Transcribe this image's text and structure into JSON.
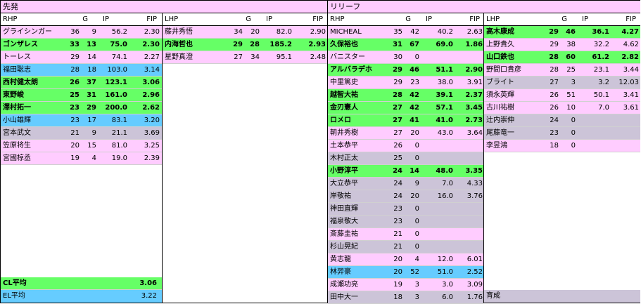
{
  "sections": {
    "starters": "先発",
    "relief": "リリーフ"
  },
  "headers": {
    "rhp": {
      "name": "RHP",
      "g": "G",
      "ip": "IP",
      "fip": "FIP"
    },
    "lhp": {
      "name": "LHP",
      "g": "G",
      "ip": "IP",
      "fip": "FIP"
    }
  },
  "starter_rhp": [
    {
      "name": "グライシンガー",
      "g": "36",
      "gs": "9",
      "ip": "56.2",
      "fip": "2.30",
      "bg": "pink",
      "bold": false
    },
    {
      "name": "ゴンザレス",
      "g": "33",
      "gs": "13",
      "ip": "75.0",
      "fip": "2.30",
      "bg": "green",
      "bold": true
    },
    {
      "name": "トーレス",
      "g": "29",
      "gs": "14",
      "ip": "74.1",
      "fip": "2.27",
      "bg": "pink",
      "bold": false
    },
    {
      "name": "福田聡志",
      "g": "28",
      "gs": "18",
      "ip": "103.0",
      "fip": "3.14",
      "bg": "blue",
      "bold": false
    },
    {
      "name": "西村健太朗",
      "g": "26",
      "gs": "37",
      "ip": "123.1",
      "fip": "3.06",
      "bg": "green",
      "bold": true
    },
    {
      "name": "東野峻",
      "g": "25",
      "gs": "31",
      "ip": "161.0",
      "fip": "2.96",
      "bg": "green",
      "bold": true
    },
    {
      "name": "澤村拓一",
      "g": "23",
      "gs": "29",
      "ip": "200.0",
      "fip": "2.62",
      "bg": "green",
      "bold": true
    },
    {
      "name": "小山雄輝",
      "g": "23",
      "gs": "17",
      "ip": "83.1",
      "fip": "3.20",
      "bg": "blue",
      "bold": false
    },
    {
      "name": "宮本武文",
      "g": "21",
      "gs": "9",
      "ip": "21.1",
      "fip": "3.69",
      "bg": "gray",
      "bold": false
    },
    {
      "name": "笠原将生",
      "g": "20",
      "gs": "15",
      "ip": "81.0",
      "fip": "3.25",
      "bg": "pink",
      "bold": false
    },
    {
      "name": "宮國椋丞",
      "g": "19",
      "gs": "4",
      "ip": "19.0",
      "fip": "2.39",
      "bg": "pink",
      "bold": false
    }
  ],
  "starter_lhp": [
    {
      "name": "藤井秀悟",
      "g": "34",
      "gs": "20",
      "ip": "82.0",
      "fip": "2.90",
      "bg": "pink",
      "bold": false
    },
    {
      "name": "内海哲也",
      "g": "29",
      "gs": "28",
      "ip": "185.2",
      "fip": "2.93",
      "bg": "green",
      "bold": true
    },
    {
      "name": "星野真澄",
      "g": "27",
      "gs": "34",
      "ip": "95.1",
      "fip": "2.48",
      "bg": "pink",
      "bold": false
    }
  ],
  "averages": [
    {
      "label": "CL平均",
      "fip": "3.06",
      "bg": "green",
      "bold": true
    },
    {
      "label": "EL平均",
      "fip": "3.22",
      "bg": "blue",
      "bold": false
    }
  ],
  "relief_rhp": [
    {
      "name": "MICHEAL",
      "g": "35",
      "gs": "42",
      "ip": "40.2",
      "fip": "2.63",
      "bg": "pink",
      "bold": false
    },
    {
      "name": "久保裕也",
      "g": "31",
      "gs": "67",
      "ip": "69.0",
      "fip": "1.86",
      "bg": "green",
      "bold": true
    },
    {
      "name": "バニスター",
      "g": "30",
      "gs": "0",
      "ip": "",
      "fip": "",
      "bg": "pink",
      "bold": false
    },
    {
      "name": "アルバラデホ",
      "g": "29",
      "gs": "46",
      "ip": "51.1",
      "fip": "2.90",
      "bg": "green",
      "bold": true
    },
    {
      "name": "中里篤史",
      "g": "29",
      "gs": "23",
      "ip": "38.0",
      "fip": "3.91",
      "bg": "pink",
      "bold": false
    },
    {
      "name": "越智大祐",
      "g": "28",
      "gs": "42",
      "ip": "39.1",
      "fip": "2.37",
      "bg": "green",
      "bold": true
    },
    {
      "name": "金刃憲人",
      "g": "27",
      "gs": "42",
      "ip": "57.1",
      "fip": "3.45",
      "bg": "green",
      "bold": true
    },
    {
      "name": "ロメロ",
      "g": "27",
      "gs": "41",
      "ip": "41.0",
      "fip": "2.73",
      "bg": "green",
      "bold": true
    },
    {
      "name": "朝井秀樹",
      "g": "27",
      "gs": "20",
      "ip": "43.0",
      "fip": "3.64",
      "bg": "pink",
      "bold": false
    },
    {
      "name": "土本恭平",
      "g": "26",
      "gs": "0",
      "ip": "",
      "fip": "",
      "bg": "pink",
      "bold": false
    },
    {
      "name": "木村正太",
      "g": "25",
      "gs": "0",
      "ip": "",
      "fip": "",
      "bg": "gray",
      "bold": false
    },
    {
      "name": "小野淳平",
      "g": "24",
      "gs": "14",
      "ip": "48.0",
      "fip": "3.35",
      "bg": "green",
      "bold": true
    },
    {
      "name": "大立恭平",
      "g": "24",
      "gs": "9",
      "ip": "7.0",
      "fip": "4.33",
      "bg": "gray",
      "bold": false
    },
    {
      "name": "岸敬祐",
      "g": "24",
      "gs": "20",
      "ip": "16.0",
      "fip": "3.76",
      "bg": "gray",
      "bold": false
    },
    {
      "name": "神田直輝",
      "g": "23",
      "gs": "0",
      "ip": "",
      "fip": "",
      "bg": "gray",
      "bold": false
    },
    {
      "name": "福泉敬大",
      "g": "23",
      "gs": "0",
      "ip": "",
      "fip": "",
      "bg": "gray",
      "bold": false
    },
    {
      "name": "斎藤圭祐",
      "g": "21",
      "gs": "0",
      "ip": "",
      "fip": "",
      "bg": "pink",
      "bold": false
    },
    {
      "name": "杉山晃紀",
      "g": "21",
      "gs": "0",
      "ip": "",
      "fip": "",
      "bg": "gray",
      "bold": false
    },
    {
      "name": "黄志龍",
      "g": "20",
      "gs": "4",
      "ip": "12.0",
      "fip": "6.01",
      "bg": "pink",
      "bold": false
    },
    {
      "name": "林羿豪",
      "g": "20",
      "gs": "52",
      "ip": "51.0",
      "fip": "2.52",
      "bg": "blue",
      "bold": false
    },
    {
      "name": "成瀬功亮",
      "g": "19",
      "gs": "3",
      "ip": "3.0",
      "fip": "3.09",
      "bg": "pink",
      "bold": false
    },
    {
      "name": "田中大一",
      "g": "18",
      "gs": "3",
      "ip": "6.0",
      "fip": "1.76",
      "bg": "gray",
      "bold": false
    }
  ],
  "relief_lhp": [
    {
      "name": "高木康成",
      "g": "29",
      "gs": "46",
      "ip": "36.1",
      "fip": "4.27",
      "bg": "green",
      "bold": true
    },
    {
      "name": "上野貴久",
      "g": "29",
      "gs": "38",
      "ip": "32.2",
      "fip": "4.62",
      "bg": "pink",
      "bold": false
    },
    {
      "name": "山口鉄也",
      "g": "28",
      "gs": "60",
      "ip": "61.2",
      "fip": "2.82",
      "bg": "green",
      "bold": true
    },
    {
      "name": "野間口貴彦",
      "g": "28",
      "gs": "25",
      "ip": "23.1",
      "fip": "3.44",
      "bg": "pink",
      "bold": false
    },
    {
      "name": "ブライト",
      "g": "27",
      "gs": "3",
      "ip": "3.2",
      "fip": "12.03",
      "bg": "gray",
      "bold": false
    },
    {
      "name": "須永英輝",
      "g": "26",
      "gs": "51",
      "ip": "50.1",
      "fip": "3.41",
      "bg": "pink",
      "bold": false
    },
    {
      "name": "古川祐樹",
      "g": "26",
      "gs": "10",
      "ip": "7.0",
      "fip": "3.61",
      "bg": "pink",
      "bold": false
    },
    {
      "name": "辻内崇伸",
      "g": "24",
      "gs": "0",
      "ip": "",
      "fip": "",
      "bg": "gray",
      "bold": false
    },
    {
      "name": "尾藤竜一",
      "g": "23",
      "gs": "0",
      "ip": "",
      "fip": "",
      "bg": "gray",
      "bold": false
    },
    {
      "name": "李昱鴻",
      "g": "18",
      "gs": "0",
      "ip": "",
      "fip": "",
      "bg": "pink",
      "bold": false
    }
  ],
  "relief_lhp_footer": {
    "label": "育成"
  }
}
